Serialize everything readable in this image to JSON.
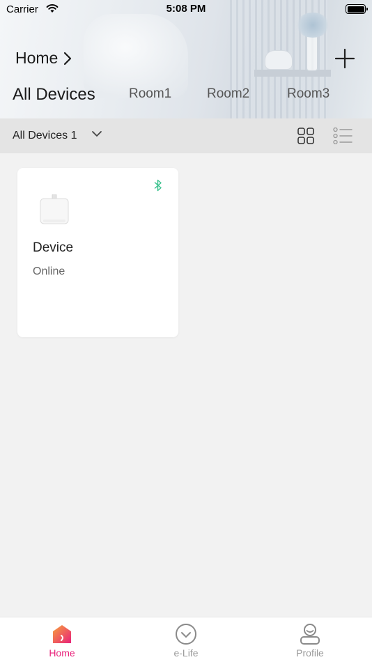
{
  "status_bar": {
    "carrier": "Carrier",
    "time": "5:08 PM"
  },
  "header": {
    "home_label": "Home"
  },
  "room_tabs": [
    {
      "label": "All Devices",
      "active": true
    },
    {
      "label": "Room1",
      "active": false
    },
    {
      "label": "Room2",
      "active": false
    },
    {
      "label": "Room3",
      "active": false
    }
  ],
  "filter": {
    "label": "All Devices 1"
  },
  "devices": [
    {
      "name": "Device",
      "status": "Online",
      "connection_icon": "bluetooth-icon"
    }
  ],
  "tab_bar": [
    {
      "label": "Home",
      "icon": "home-icon",
      "active": true
    },
    {
      "label": "e-Life",
      "icon": "elife-icon",
      "active": false
    },
    {
      "label": "Profile",
      "icon": "profile-icon",
      "active": false
    }
  ],
  "colors": {
    "accent": "#e8227a",
    "bluetooth": "#3dc28f",
    "background": "#f2f2f2",
    "filter_bar": "#e4e4e4"
  }
}
